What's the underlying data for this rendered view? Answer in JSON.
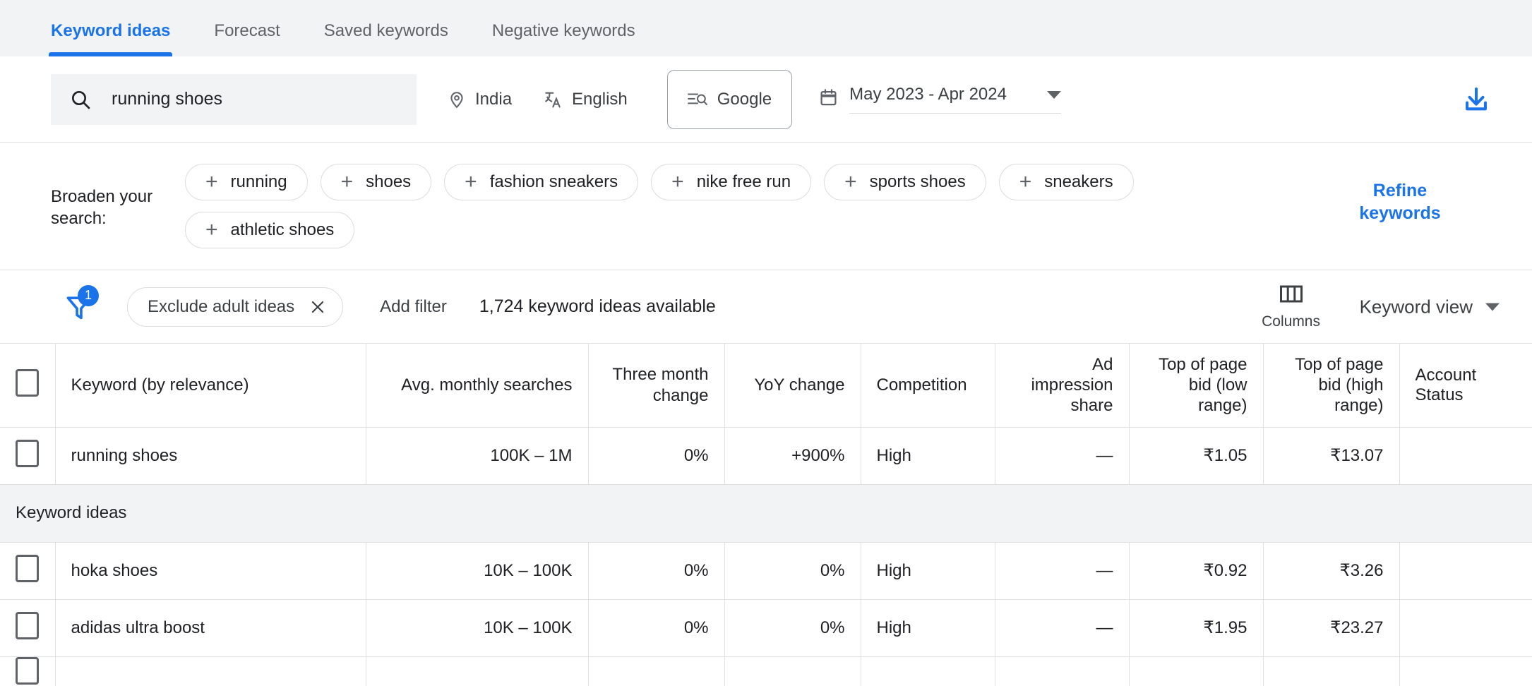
{
  "tabs": [
    {
      "label": "Keyword ideas",
      "active": true
    },
    {
      "label": "Forecast",
      "active": false
    },
    {
      "label": "Saved keywords",
      "active": false
    },
    {
      "label": "Negative keywords",
      "active": false
    }
  ],
  "search": {
    "value": "running shoes",
    "placeholder": "Enter a keyword",
    "search_icon": "search-icon",
    "location": {
      "label": "India",
      "icon": "location-pin-icon"
    },
    "language": {
      "label": "English",
      "icon": "translate-icon"
    },
    "network": {
      "label": "Google",
      "icon": "search-network-icon"
    },
    "date_range": {
      "label": "May 2023 - Apr 2024",
      "icon": "calendar-icon"
    },
    "download": {
      "icon": "download-icon",
      "color": "#1a73e8"
    }
  },
  "broaden": {
    "label": "Broaden your search:",
    "chips": [
      "running",
      "shoes",
      "fashion sneakers",
      "nike free run",
      "sports shoes",
      "sneakers",
      "athletic shoes"
    ],
    "refine_link": "Refine keywords",
    "refine_color": "#1a73e8"
  },
  "filters": {
    "filter_icon": "filter-icon",
    "filter_count": "1",
    "badge_color": "#1a73e8",
    "applied": [
      {
        "label": "Exclude adult ideas",
        "remove_icon": "close-icon"
      }
    ],
    "add_filter": "Add filter",
    "available_text": "1,724 keyword ideas available",
    "columns_label": "Columns",
    "columns_icon": "columns-icon",
    "view_label": "Keyword view",
    "view_caret": "chevron-down-icon"
  },
  "table": {
    "columns": [
      "Keyword (by relevance)",
      "Avg. monthly searches",
      "Three month change",
      "YoY change",
      "Competition",
      "Ad impression share",
      "Top of page bid (low range)",
      "Top of page bid (high range)",
      "Account Status"
    ],
    "section_label": "Keyword ideas",
    "rows": [
      {
        "keyword": "running shoes",
        "avg_monthly_searches": "100K – 1M",
        "three_month_change": "0%",
        "yoy_change": "+900%",
        "competition": "High",
        "ad_impression_share": "—",
        "bid_low": "₹1.05",
        "bid_high": "₹13.07",
        "account_status": ""
      },
      {
        "keyword": "hoka shoes",
        "avg_monthly_searches": "10K – 100K",
        "three_month_change": "0%",
        "yoy_change": "0%",
        "competition": "High",
        "ad_impression_share": "—",
        "bid_low": "₹0.92",
        "bid_high": "₹3.26",
        "account_status": ""
      },
      {
        "keyword": "adidas ultra boost",
        "avg_monthly_searches": "10K – 100K",
        "three_month_change": "0%",
        "yoy_change": "0%",
        "competition": "High",
        "ad_impression_share": "—",
        "bid_low": "₹1.95",
        "bid_high": "₹23.27",
        "account_status": ""
      }
    ]
  }
}
